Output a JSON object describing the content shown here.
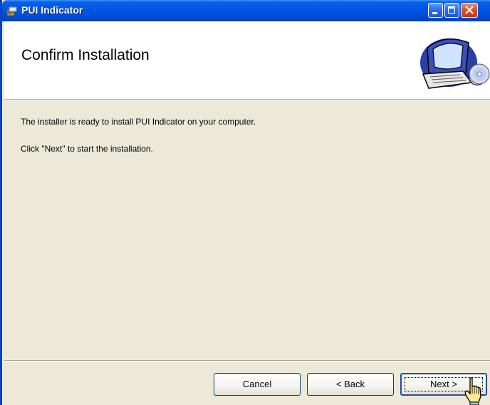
{
  "window": {
    "title": "PUI Indicator"
  },
  "header": {
    "title": "Confirm Installation"
  },
  "body": {
    "line1": "The installer is ready to install PUI Indicator on your computer.",
    "line2": "Click \"Next\" to start the installation."
  },
  "buttons": {
    "cancel": "Cancel",
    "back": "< Back",
    "next": "Next >"
  },
  "colors": {
    "titlebar": "#0055e5",
    "dialog_bg": "#ece9d8",
    "close_button": "#e0502b",
    "button_border": "#003c74"
  },
  "icons": {
    "title": "installer-package-icon",
    "banner": "computer-cd-icon",
    "cursor": "hand-pointer-icon"
  }
}
